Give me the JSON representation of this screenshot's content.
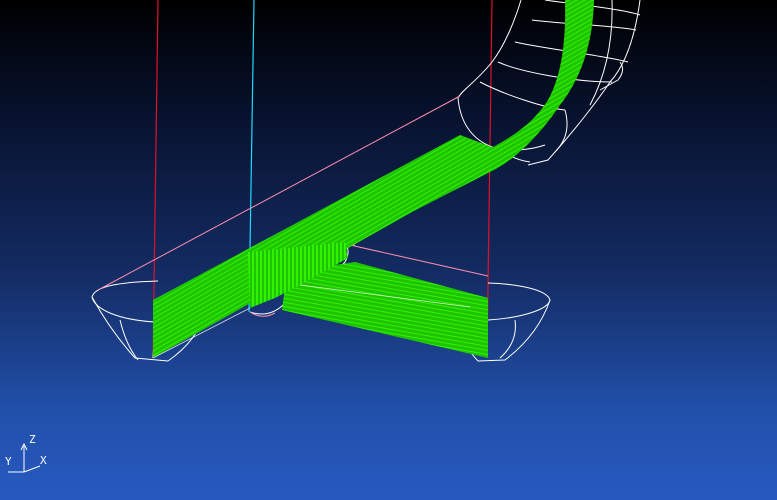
{
  "viewport": {
    "background_top": "#000000",
    "background_bottom": "#2759c0"
  },
  "colors": {
    "toolpath": "#2bff00",
    "wireframe": "#ffffff",
    "boundary": "#ff8fb0",
    "vertical_lines": "#e0102a",
    "spindle_axis": "#20d8ff"
  },
  "axes": {
    "z": "Z",
    "y": "Y",
    "x": "X"
  }
}
